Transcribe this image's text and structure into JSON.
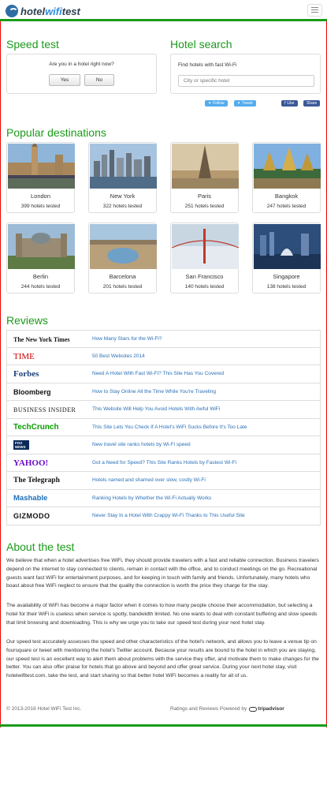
{
  "brand": {
    "part1": "hotel",
    "part2": "wifi",
    "part3": "test"
  },
  "speed_test": {
    "title": "Speed test",
    "question": "Are you in a hotel right now?",
    "yes": "Yes",
    "no": "No"
  },
  "hotel_search": {
    "title": "Hotel search",
    "label": "Find hotels with fast Wi-Fi",
    "placeholder": "City or specific hotel"
  },
  "social": {
    "follow": "Follow",
    "tweet": "Tweet",
    "like": "Like",
    "share": "Share"
  },
  "popular": {
    "title": "Popular destinations",
    "cities": [
      {
        "name": "London",
        "count": "399 hotels tested"
      },
      {
        "name": "New York",
        "count": "322 hotels tested"
      },
      {
        "name": "Paris",
        "count": "251 hotels tested"
      },
      {
        "name": "Bangkok",
        "count": "247 hotels tested"
      },
      {
        "name": "Berlin",
        "count": "244 hotels tested"
      },
      {
        "name": "Barcelona",
        "count": "201 hotels tested"
      },
      {
        "name": "San Francisco",
        "count": "140 hotels tested"
      },
      {
        "name": "Singapore",
        "count": "138 hotels tested"
      }
    ]
  },
  "reviews": {
    "title": "Reviews",
    "items": [
      {
        "source": "The New York Times",
        "headline": "How Many Stars for the Wi-Fi?"
      },
      {
        "source": "TIME",
        "headline": "50 Best Websites 2014"
      },
      {
        "source": "Forbes",
        "headline": "Need A Hotel With Fast Wi-Fi? This Site Has You Covered"
      },
      {
        "source": "Bloomberg",
        "headline": "How to Stay Online All the Time While You're Traveling"
      },
      {
        "source": "BUSINESS INSIDER",
        "headline": "This Website Will Help You Avoid Hotels With Awful WiFi"
      },
      {
        "source": "TechCrunch",
        "headline": "This Site Lets You Check If A Hotel's WiFi Sucks Before It's Too Late"
      },
      {
        "source": "FOX NEWS",
        "headline": "New travel site ranks hotels by Wi-Fi speed"
      },
      {
        "source": "YAHOO!",
        "headline": "Got a Need for Speed? This Site Ranks Hotels by Fastest Wi-Fi"
      },
      {
        "source": "The Telegraph",
        "headline": "Hotels named and shamed over slow, costly Wi-Fi"
      },
      {
        "source": "Mashable",
        "headline": "Ranking Hotels by Whether the Wi-Fi Actually Works"
      },
      {
        "source": "GIZMODO",
        "headline": "Never Stay In a Hotel With Crappy Wi-Fi Thanks to This Useful Site"
      }
    ]
  },
  "about": {
    "title": "About the test",
    "p1": "We believe that when a hotel advertises free WiFi, they should provide travelers with a fast and reliable connection. Business travelers depend on the internet to stay connected to clients, remain in contact with the office, and to conduct meetings on the go. Recreational guests want fast WiFi for entertainment purposes, and for keeping in touch with family and friends. Unfortunately, many hotels who boast about free WiFi neglect to ensure that the quality the connection is worth the price they charge for the stay.",
    "p2": "The availability of WiFi has become a major factor when it comes to how many people choose their accommodation, but selecting a hotel for their WiFi is useless when service is spotty, bandwidth limited. No one wants to deal with constant buffering and slow speeds that limit browsing and downloading. This is why we urge you to take our speed test during your next hotel stay.",
    "p3": "Our speed test accurately assesses the speed and other characteristics of the hotel's network, and allows you to leave a venue tip on foursquare or tweet with mentioning the hotel's Twitter account. Because your results are bound to the hotel in which you are staying, our speed test is an excellent way to alert them about problems with the service they offer, and motivate them to make changes for the better. You can also offer praise for hotels that go above and beyond and offer great service. During your next hotel stay, visit hotelwifitest.com, take the test, and start sharing so that better hotel WiFi becomes a reality for all of us."
  },
  "footer": {
    "copyright": "© 2013-2016 Hotel WiFi Test Inc.",
    "powered": "Ratings and Reviews Powered by",
    "tripadvisor": "tripadvisor"
  },
  "colors": {
    "accent": "#1a9b1a",
    "link": "#2a70b8",
    "frame": "#ee0000"
  }
}
